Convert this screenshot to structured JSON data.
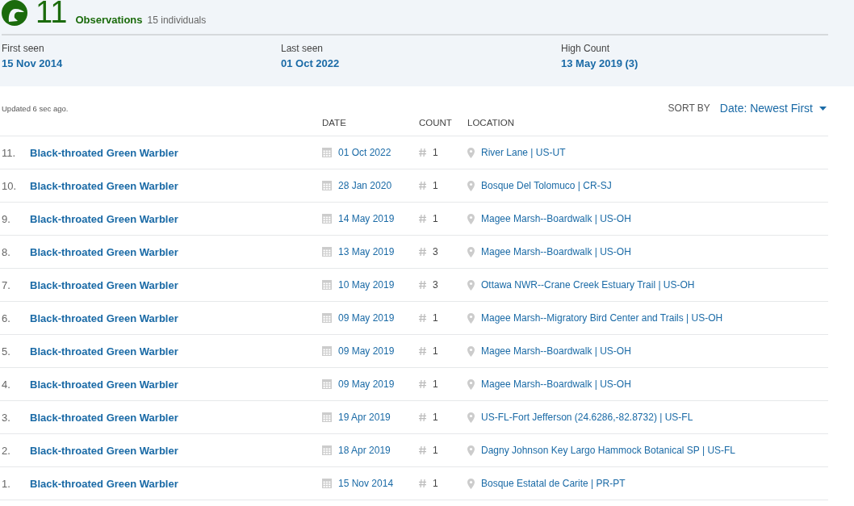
{
  "summary": {
    "count": "11",
    "label": "Observations",
    "individuals": "15 individuals"
  },
  "stats": [
    {
      "label": "First seen",
      "value": "15 Nov 2014"
    },
    {
      "label": "Last seen",
      "value": "01 Oct 2022"
    },
    {
      "label": "High Count",
      "value": "13 May 2019 (3)"
    }
  ],
  "updated": "Updated 6 sec ago.",
  "sort": {
    "label": "SORT BY",
    "value": "Date: Newest First"
  },
  "table": {
    "columns": [
      "DATE",
      "COUNT",
      "LOCATION"
    ],
    "rows": [
      {
        "index": "11.",
        "species": "Black-throated Green Warbler",
        "date": "01 Oct 2022",
        "count": "1",
        "location": "River Lane | US-UT"
      },
      {
        "index": "10.",
        "species": "Black-throated Green Warbler",
        "date": "28 Jan 2020",
        "count": "1",
        "location": "Bosque Del Tolomuco | CR-SJ"
      },
      {
        "index": "9.",
        "species": "Black-throated Green Warbler",
        "date": "14 May 2019",
        "count": "1",
        "location": "Magee Marsh--Boardwalk | US-OH"
      },
      {
        "index": "8.",
        "species": "Black-throated Green Warbler",
        "date": "13 May 2019",
        "count": "3",
        "location": "Magee Marsh--Boardwalk | US-OH"
      },
      {
        "index": "7.",
        "species": "Black-throated Green Warbler",
        "date": "10 May 2019",
        "count": "3",
        "location": "Ottawa NWR--Crane Creek Estuary Trail | US-OH"
      },
      {
        "index": "6.",
        "species": "Black-throated Green Warbler",
        "date": "09 May 2019",
        "count": "1",
        "location": "Magee Marsh--Migratory Bird Center and Trails | US-OH"
      },
      {
        "index": "5.",
        "species": "Black-throated Green Warbler",
        "date": "09 May 2019",
        "count": "1",
        "location": "Magee Marsh--Boardwalk | US-OH"
      },
      {
        "index": "4.",
        "species": "Black-throated Green Warbler",
        "date": "09 May 2019",
        "count": "1",
        "location": "Magee Marsh--Boardwalk | US-OH"
      },
      {
        "index": "3.",
        "species": "Black-throated Green Warbler",
        "date": "19 Apr 2019",
        "count": "1",
        "location": "US-FL-Fort Jefferson (24.6286,-82.8732) | US-FL"
      },
      {
        "index": "2.",
        "species": "Black-throated Green Warbler",
        "date": "18 Apr 2019",
        "count": "1",
        "location": "Dagny Johnson Key Largo Hammock Botanical SP | US-FL"
      },
      {
        "index": "1.",
        "species": "Black-throated Green Warbler",
        "date": "15 Nov 2014",
        "count": "1",
        "location": "Bosque Estatal de Carite | PR-PT"
      }
    ]
  }
}
